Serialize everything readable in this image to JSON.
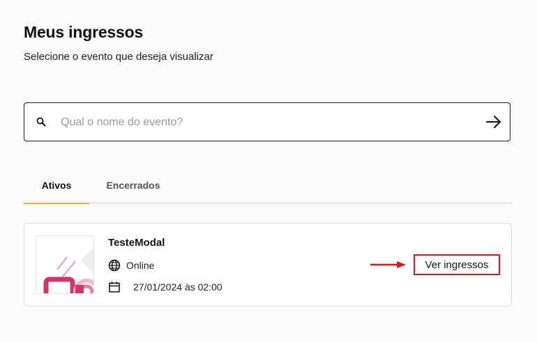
{
  "header": {
    "title": "Meus ingressos",
    "subtitle": "Selecione o evento que deseja visualizar"
  },
  "search": {
    "placeholder": "Qual o nome do evento?",
    "value": "",
    "icon": "search-icon",
    "submit_icon": "arrow-right-icon"
  },
  "tabs": [
    {
      "label": "Ativos",
      "active": true
    },
    {
      "label": "Encerrados",
      "active": false
    }
  ],
  "colors": {
    "accent": "#e0b92b",
    "annotation": "#e0131b",
    "thumbnail_pink": "#d6336c"
  },
  "events": [
    {
      "title": "TesteModal",
      "mode": "Online",
      "mode_icon": "globe-icon",
      "date": "27/01/2024 às 02:00",
      "date_icon": "calendar-icon",
      "action_label": "Ver ingressos"
    }
  ]
}
